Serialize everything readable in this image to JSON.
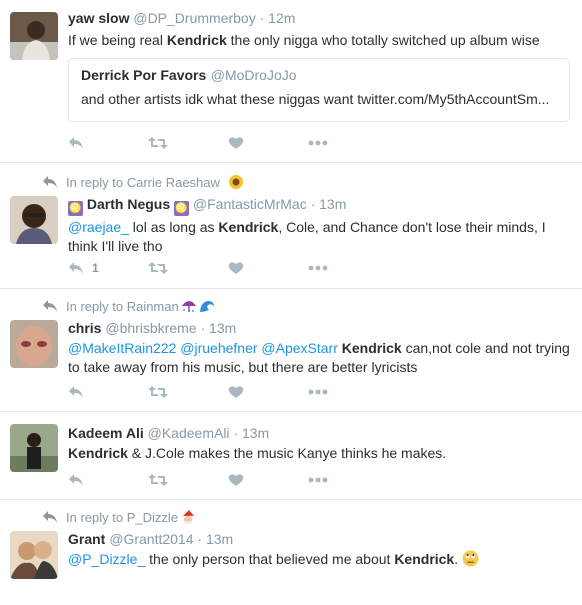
{
  "tweets": [
    {
      "name": "yaw slow",
      "handle": "@DP_Drummerboy",
      "time": "· 12m",
      "text_pre": "If we being real ",
      "text_bold": "Kendrick",
      "text_post": " the only nigga who totally switched up album wise",
      "quote": {
        "name": "Derrick Por Favors",
        "handle": "@MoDroJoJo",
        "text": "and other artists idk what these niggas want twitter.com/My5thAccountSm..."
      }
    },
    {
      "reply_to": "In reply to Carrie Raeshaw",
      "reply_emoji": "sunflower",
      "name": "Darth Negus",
      "name_badge": "♌",
      "handle": "@FantasticMrMac",
      "time": "· 13m",
      "mention": "@raejae_",
      "text_pre": " lol as long as ",
      "text_bold": "Kendrick",
      "text_post": ", Cole, and Chance don't lose their minds, I think I'll live tho",
      "reply_count": "1"
    },
    {
      "reply_to": "In reply to Rainman",
      "reply_emoji": "umbrella-rain wave",
      "name": "chris",
      "handle": "@bhrisbkreme",
      "time": "· 13m",
      "mentions": "@MakeItRain222 @jruehefner @ApexStarr",
      "text_bold": "Kendrick",
      "text_post": " can,not cole and not trying to take away from his music, but there are better lyricists"
    },
    {
      "name": "Kadeem Ali",
      "handle": "@KadeemAli",
      "time": "· 13m",
      "text_bold": "Kendrick",
      "text_post": " & J.Cole makes the music Kanye thinks he makes."
    },
    {
      "reply_to": "In reply to P_Dizzle",
      "reply_emoji": "santa",
      "name": "Grant",
      "handle": "@Grantt2014",
      "time": "· 13m",
      "mention": "@P_Dizzle_",
      "text_pre": " the only person that believed me about ",
      "text_bold": "Kendrick",
      "text_post": ".",
      "text_emoji": "rolling-eyes"
    }
  ],
  "icons": {
    "reply": "reply-icon",
    "retweet": "retweet-icon",
    "like": "heart-icon",
    "more": "more-icon"
  },
  "colors": {
    "link": "#1b95e0",
    "muted": "#8899a6",
    "icon": "#aab8c2",
    "border": "#e1e8ed"
  }
}
